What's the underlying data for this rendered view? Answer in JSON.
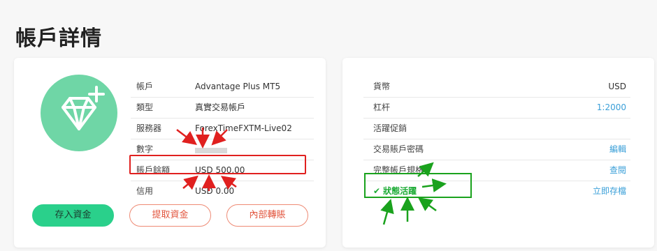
{
  "page": {
    "title": "帳戶詳情"
  },
  "account": {
    "rows": [
      {
        "label": "帳戶",
        "value": "Advantage Plus MT5"
      },
      {
        "label": "類型",
        "value": "真實交易帳戶"
      },
      {
        "label": "服務器",
        "value": "ForexTimeFXTM-Live02"
      },
      {
        "label": "數字",
        "value": ""
      },
      {
        "label": "賬戶餘額",
        "value": "USD 500.00"
      },
      {
        "label": "信用",
        "value": "USD 0.00"
      }
    ],
    "buttons": {
      "deposit": "存入資金",
      "withdraw": "提取資金",
      "transfer": "內部轉賬"
    }
  },
  "details": {
    "currency": {
      "label": "貨幣",
      "value": "USD"
    },
    "leverage": {
      "label": "杠杆",
      "value": "1:2000"
    },
    "promo": {
      "label": "活躍促銷"
    },
    "password": {
      "label": "交易賬戶密碼",
      "value": "編輯"
    },
    "specs": {
      "label": "完整帳戶規格",
      "value": "查閱"
    },
    "status": {
      "label": "狀態活躍",
      "action": "立即存檔"
    }
  },
  "colors": {
    "accent_green": "#2ad08b",
    "highlight_red": "#e0201f",
    "highlight_green": "#1aa21d",
    "link_blue": "#3a9fd8",
    "outline_orange": "#ee8a74"
  },
  "icons": {
    "avatar": "diamond-plus-icon",
    "status": "checkmark-icon"
  }
}
